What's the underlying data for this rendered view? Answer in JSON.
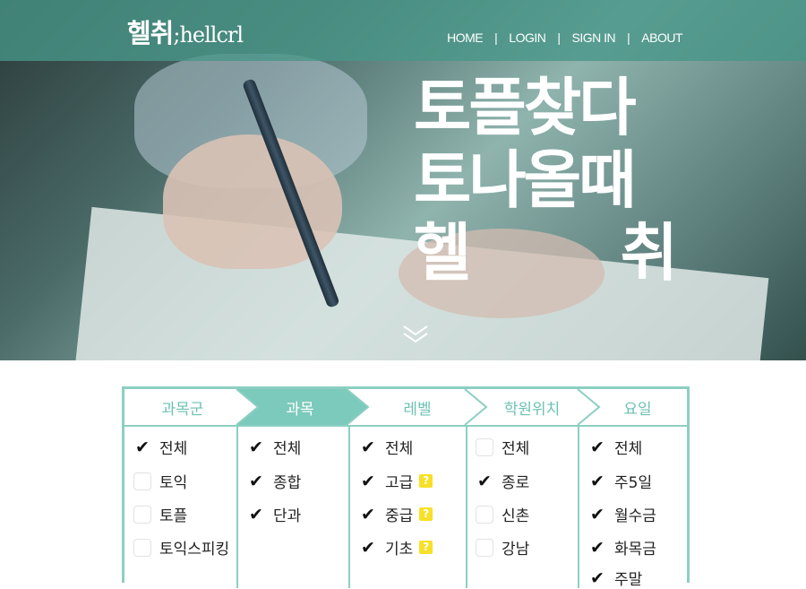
{
  "header": {
    "logo_main": "헬취",
    "logo_sub": ";hellcrl",
    "nav": [
      "HOME",
      "LOGIN",
      "SIGN IN",
      "ABOUT"
    ],
    "nav_separator": "|"
  },
  "hero": {
    "line1": "토플찾다",
    "line2": "토나올때",
    "line3a": "헬",
    "line3b": "취",
    "scroll_icon": "double-chevron-down-icon"
  },
  "filter": {
    "accent_color": "#8ccfc2",
    "active_tab_color": "#7ccabb",
    "tabs": [
      "과목군",
      "과목",
      "레벨",
      "학원위치",
      "요일"
    ],
    "active_tab": "과목",
    "columns": [
      {
        "items": [
          {
            "label": "전체",
            "checked": true
          },
          {
            "label": "토익",
            "checked": false
          },
          {
            "label": "토플",
            "checked": false
          },
          {
            "label": "토익스피킹",
            "checked": false
          }
        ]
      },
      {
        "items": [
          {
            "label": "전체",
            "checked": true
          },
          {
            "label": "종합",
            "checked": true
          },
          {
            "label": "단과",
            "checked": true
          }
        ]
      },
      {
        "items": [
          {
            "label": "전체",
            "checked": true,
            "help": false
          },
          {
            "label": "고급",
            "checked": true,
            "help": true
          },
          {
            "label": "중급",
            "checked": true,
            "help": true
          },
          {
            "label": "기초",
            "checked": true,
            "help": true
          }
        ]
      },
      {
        "items": [
          {
            "label": "전체",
            "checked": false
          },
          {
            "label": "종로",
            "checked": true
          },
          {
            "label": "신촌",
            "checked": false
          },
          {
            "label": "강남",
            "checked": false
          }
        ]
      },
      {
        "items": [
          {
            "label": "전체",
            "checked": true
          },
          {
            "label": "주5일",
            "checked": true
          },
          {
            "label": "월수금",
            "checked": true
          },
          {
            "label": "화목금",
            "checked": true
          },
          {
            "label": "주말",
            "checked": true
          }
        ]
      }
    ],
    "help_glyph": "?"
  }
}
